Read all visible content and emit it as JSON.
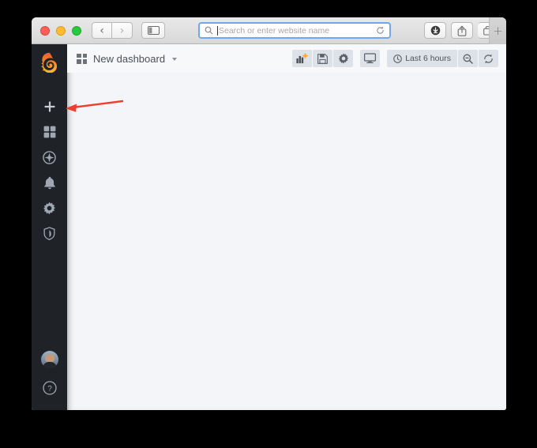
{
  "browser": {
    "traffic_lights": [
      "close",
      "minimize",
      "maximize"
    ],
    "back_label": "‹",
    "forward_label": "›",
    "sidebar_toggle_icon": "sidebar-icon",
    "address": {
      "value": "",
      "placeholder": "Search or enter website name",
      "search_icon": "search-icon",
      "reload_icon": "reload-icon"
    },
    "right_buttons": [
      {
        "name": "downloads-button",
        "icon": "download-icon"
      },
      {
        "name": "share-button",
        "icon": "share-icon"
      },
      {
        "name": "tab-overview-button",
        "icon": "tabs-icon"
      }
    ],
    "new_tab_label": "+"
  },
  "app": {
    "brand": "grafana-logo",
    "sidebar": {
      "items": [
        {
          "name": "sidebar-item-create",
          "icon": "plus-icon",
          "label": "Create"
        },
        {
          "name": "sidebar-item-dashboards",
          "icon": "grid-icon",
          "label": "Dashboards"
        },
        {
          "name": "sidebar-item-explore",
          "icon": "compass-icon",
          "label": "Explore"
        },
        {
          "name": "sidebar-item-alerting",
          "icon": "bell-icon",
          "label": "Alerting"
        },
        {
          "name": "sidebar-item-configuration",
          "icon": "gear-icon",
          "label": "Configuration"
        },
        {
          "name": "sidebar-item-server-admin",
          "icon": "shield-icon",
          "label": "Server Admin"
        }
      ],
      "avatar": {
        "name": "avatar",
        "label": "User profile"
      },
      "help": {
        "name": "help-icon",
        "label": "?"
      }
    },
    "dashboard": {
      "title": "New dashboard",
      "caret": "▾",
      "grid_icon": "grid-icon",
      "toolbar": [
        {
          "name": "add-panel-button",
          "icon": "add-panel-icon",
          "label": ""
        },
        {
          "name": "save-dashboard-button",
          "icon": "save-icon",
          "label": ""
        },
        {
          "name": "dashboard-settings-button",
          "icon": "gear-icon",
          "label": ""
        },
        {
          "name": "kiosk-mode-button",
          "icon": "monitor-icon",
          "label": ""
        }
      ],
      "time_picker": {
        "name": "time-range-picker",
        "icon": "clock-icon",
        "label": "Last 6 hours"
      },
      "zoom_out": {
        "name": "zoom-out-button",
        "icon": "search-minus-icon"
      },
      "refresh": {
        "name": "refresh-button",
        "icon": "refresh-icon"
      }
    }
  },
  "annotation": {
    "name": "callout-arrow",
    "color": "#ef3e2c",
    "points_to": "sidebar-item-create"
  }
}
